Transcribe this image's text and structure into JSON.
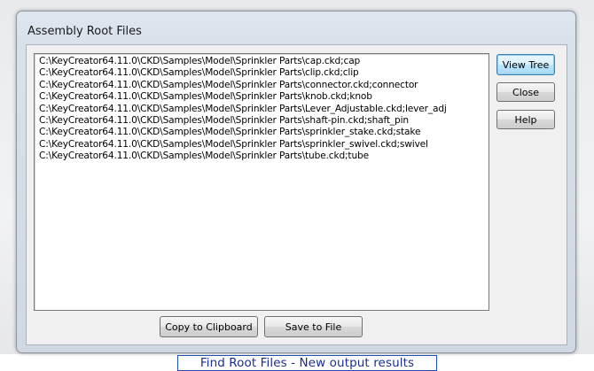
{
  "dialog": {
    "title": "Assembly Root Files",
    "file_list": [
      "C:\\KeyCreator64.11.0\\CKD\\Samples\\Model\\Sprinkler Parts\\cap.ckd;cap",
      "C:\\KeyCreator64.11.0\\CKD\\Samples\\Model\\Sprinkler Parts\\clip.ckd;clip",
      "C:\\KeyCreator64.11.0\\CKD\\Samples\\Model\\Sprinkler Parts\\connector.ckd;connector",
      "C:\\KeyCreator64.11.0\\CKD\\Samples\\Model\\Sprinkler Parts\\knob.ckd;knob",
      "C:\\KeyCreator64.11.0\\CKD\\Samples\\Model\\Sprinkler Parts\\Lever_Adjustable.ckd;lever_adj",
      "C:\\KeyCreator64.11.0\\CKD\\Samples\\Model\\Sprinkler Parts\\shaft-pin.ckd;shaft_pin",
      "C:\\KeyCreator64.11.0\\CKD\\Samples\\Model\\Sprinkler Parts\\sprinkler_stake.ckd;stake",
      "C:\\KeyCreator64.11.0\\CKD\\Samples\\Model\\Sprinkler Parts\\sprinkler_swivel.ckd;swivel",
      "C:\\KeyCreator64.11.0\\CKD\\Samples\\Model\\Sprinkler Parts\\tube.ckd;tube"
    ],
    "buttons": {
      "view_tree": "View Tree",
      "close": "Close",
      "help": "Help",
      "copy_to_clipboard": "Copy to Clipboard",
      "save_to_file": "Save to File"
    }
  },
  "caption": "Find Root Files - New output results"
}
